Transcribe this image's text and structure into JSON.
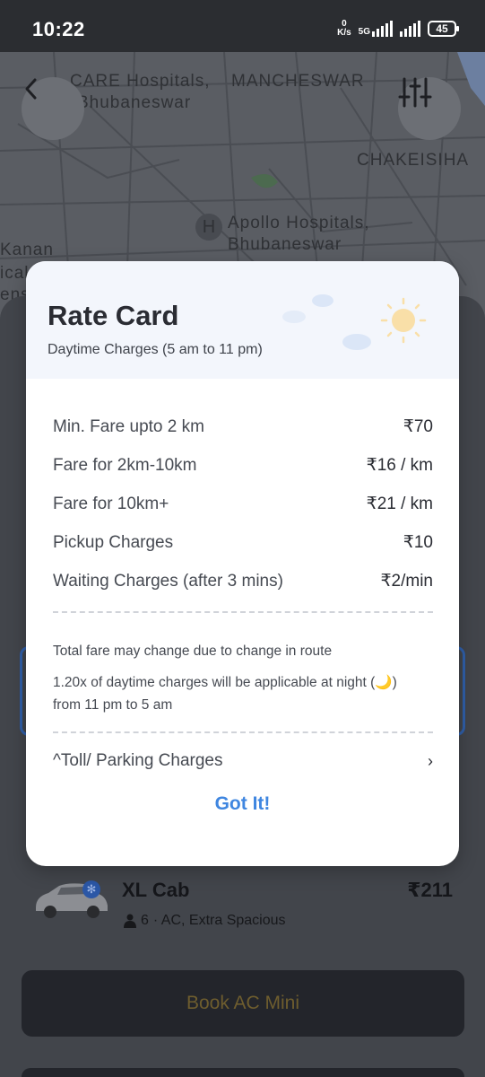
{
  "status_bar": {
    "time": "10:22",
    "net_speed_value": "0",
    "net_speed_unit": "K/s",
    "network_gen": "5G",
    "battery": "45"
  },
  "map": {
    "labels": {
      "care_hospitals_line1": "CARE Hospitals,",
      "care_hospitals_line2": "Bhubaneswar",
      "mancheswar": "MANCHESWAR",
      "chakeisihani": "CHAKEISIHA",
      "apollo_line1": "Apollo Hospitals,",
      "apollo_line2": "Bhubaneswar",
      "kanan": "Kanan",
      "ical": "ical",
      "ens": "ens"
    }
  },
  "rate_card": {
    "title": "Rate Card",
    "subtitle": "Daytime Charges (5 am to 11 pm)",
    "fares": [
      {
        "label": "Min. Fare upto 2 km",
        "value": "₹70"
      },
      {
        "label": "Fare for 2km-10km",
        "value": "₹16 / km"
      },
      {
        "label": "Fare for 10km+",
        "value": "₹21 / km"
      },
      {
        "label": "Pickup Charges",
        "value": "₹10"
      },
      {
        "label": "Waiting Charges (after 3 mins)",
        "value": "₹2/min"
      }
    ],
    "note_route": "Total fare may change due to change in route",
    "note_night_line1": "1.20x of daytime charges will be applicable at night (🌙)",
    "note_night_line2": "from 11 pm to 5 am",
    "toll_label": "^Toll/ Parking Charges",
    "got_it": "Got It!"
  },
  "ride_option": {
    "name": "XL Cab",
    "price": "₹211",
    "seats": "6",
    "features": "· AC, Extra Spacious"
  },
  "book_button": "Book AC Mini",
  "colors": {
    "accent_blue": "#3f86e0",
    "overlay_dark": "#2b2d31"
  }
}
